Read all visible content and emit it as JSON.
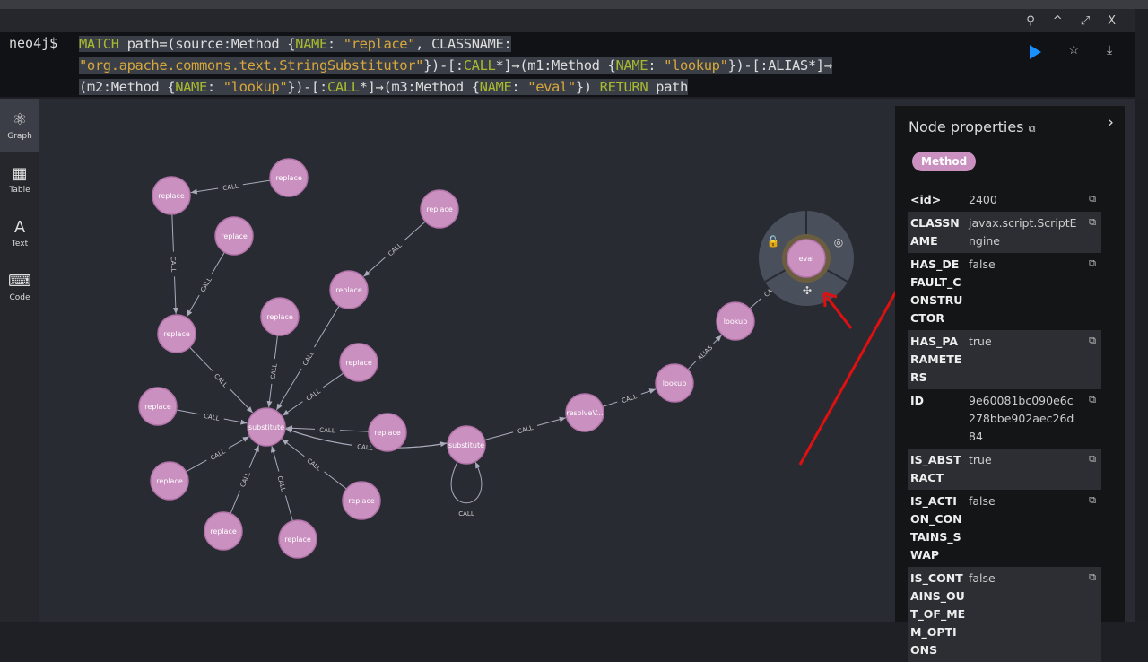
{
  "window": {
    "pin": "⚲",
    "collapse": "^",
    "expand": "⤢",
    "close": "X"
  },
  "editor": {
    "prompt": "neo4j$",
    "query_lines": [
      [
        [
          "kw",
          "MATCH"
        ],
        [
          "pl",
          " path=(source:Method {"
        ],
        [
          "kw",
          "NAME"
        ],
        [
          "pl",
          ": "
        ],
        [
          "str",
          "\"replace\""
        ],
        [
          "pl",
          ", CLASSNAME:"
        ]
      ],
      [
        [
          "str",
          "\"org.apache.commons.text.StringSubstitutor\""
        ],
        [
          "pl",
          "})-[:"
        ],
        [
          "kw",
          "CALL"
        ],
        [
          "pl",
          "*]→(m1:Method {"
        ],
        [
          "kw",
          "NAME"
        ],
        [
          "pl",
          ": "
        ],
        [
          "str",
          "\"lookup\""
        ],
        [
          "pl",
          "})-[:ALIAS*]→"
        ]
      ],
      [
        [
          "pl",
          "(m2:Method {"
        ],
        [
          "kw",
          "NAME"
        ],
        [
          "pl",
          ": "
        ],
        [
          "str",
          "\"lookup\""
        ],
        [
          "pl",
          "})-[:"
        ],
        [
          "kw",
          "CALL"
        ],
        [
          "pl",
          "*]→(m3:Method {"
        ],
        [
          "kw",
          "NAME"
        ],
        [
          "pl",
          ": "
        ],
        [
          "str",
          "\"eval\""
        ],
        [
          "pl",
          "}) "
        ],
        [
          "kw",
          "RETURN"
        ],
        [
          "pl",
          " path"
        ]
      ]
    ],
    "run_color": "#1a8fff",
    "favorite": "☆",
    "download": "⤓"
  },
  "sidebar": [
    {
      "label": "Graph",
      "icon": "graph-icon",
      "glyph": "⚛"
    },
    {
      "label": "Table",
      "icon": "table-icon",
      "glyph": "▦"
    },
    {
      "label": "Text",
      "icon": "text-icon",
      "glyph": "A"
    },
    {
      "label": "Code",
      "icon": "code-icon",
      "glyph": "⌨"
    }
  ],
  "graph": {
    "node_color": "#c990c0",
    "nodes": [
      "replace",
      "replace",
      "replace",
      "replace",
      "replace",
      "replace",
      "replace",
      "replace",
      "replace",
      "substitute",
      "replace",
      "substitute",
      "replace",
      "replace",
      "replace",
      "replace",
      "resolveV...",
      "lookup",
      "lookup",
      "eval"
    ],
    "edges": [
      [
        1,
        0,
        "CALL"
      ],
      [
        0,
        4,
        "CALL"
      ],
      [
        2,
        4,
        "CALL"
      ],
      [
        4,
        9,
        "CALL"
      ],
      [
        3,
        5,
        "CALL"
      ],
      [
        5,
        9,
        "CALL"
      ],
      [
        6,
        9,
        "CALL"
      ],
      [
        7,
        9,
        "CALL"
      ],
      [
        8,
        9,
        "CALL"
      ],
      [
        12,
        9,
        "CALL"
      ],
      [
        14,
        9,
        "CALL"
      ],
      [
        15,
        9,
        "CALL"
      ],
      [
        13,
        9,
        "CALL"
      ],
      [
        10,
        9,
        "CALL"
      ],
      [
        11,
        9,
        "CALL"
      ],
      [
        9,
        11,
        "CALL"
      ],
      [
        11,
        11,
        "CALL"
      ],
      [
        11,
        16,
        "CALL"
      ],
      [
        16,
        17,
        "CALL"
      ],
      [
        17,
        18,
        "ALIAS"
      ],
      [
        18,
        19,
        "CALL"
      ]
    ],
    "selected": "eval",
    "ring_actions": [
      "unlock-icon",
      "hide-icon",
      "expand-icon"
    ]
  },
  "panel": {
    "title": "Node properties",
    "label": "Method",
    "properties": [
      {
        "key": "<id>",
        "value": "2400"
      },
      {
        "key": "CLASSNAME",
        "value": "javax.script.ScriptEngine"
      },
      {
        "key": "HAS_DEFAULT_CONSTRUCTOR",
        "value": "false"
      },
      {
        "key": "HAS_PARAMETERS",
        "value": "true"
      },
      {
        "key": "ID",
        "value": "9e60081bc090e6c278bbe902aec26d84"
      },
      {
        "key": "IS_ABSTRACT",
        "value": "true"
      },
      {
        "key": "IS_ACTION_CONTAINS_SWAP",
        "value": "false"
      },
      {
        "key": "IS_CONTAINS_OUT_OF_MEM_OPTIONS",
        "value": "false"
      }
    ]
  }
}
